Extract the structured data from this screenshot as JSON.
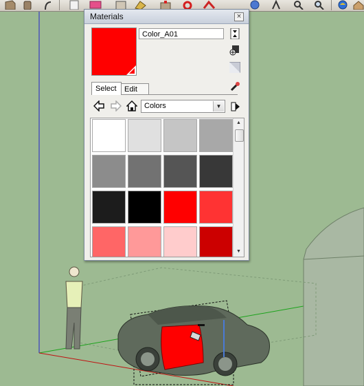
{
  "toolbar": {
    "icons": [
      "box-icon",
      "paint-bucket-icon",
      "orbit-icon",
      "component-icon",
      "eraser-icon",
      "push-pull-icon",
      "rotate-icon",
      "move-icon",
      "walk-icon",
      "zoom-icon",
      "zoom-extents-icon",
      "globe-icon",
      "house-icon"
    ]
  },
  "materials_panel": {
    "title": "Materials",
    "close_label": "×",
    "material_name": "Color_A01",
    "preview_color": "#ff0000",
    "tabs": [
      "Select",
      "Edit"
    ],
    "active_tab": "Select",
    "collection": "Colors",
    "swatches": [
      "#ffffff",
      "#e0e0e0",
      "#c5c5c5",
      "#a8a8a8",
      "#8c8c8c",
      "#727272",
      "#555555",
      "#383838",
      "#1c1c1c",
      "#000000",
      "#ff0000",
      "#ff3333",
      "#ff6666",
      "#ff9999",
      "#ffcccc",
      "#cc0000"
    ]
  },
  "colors": {
    "viewport_bg": "#9dba92",
    "red_axis": "#c00000",
    "green_axis": "#00aa00",
    "blue_axis": "#0000cc"
  }
}
